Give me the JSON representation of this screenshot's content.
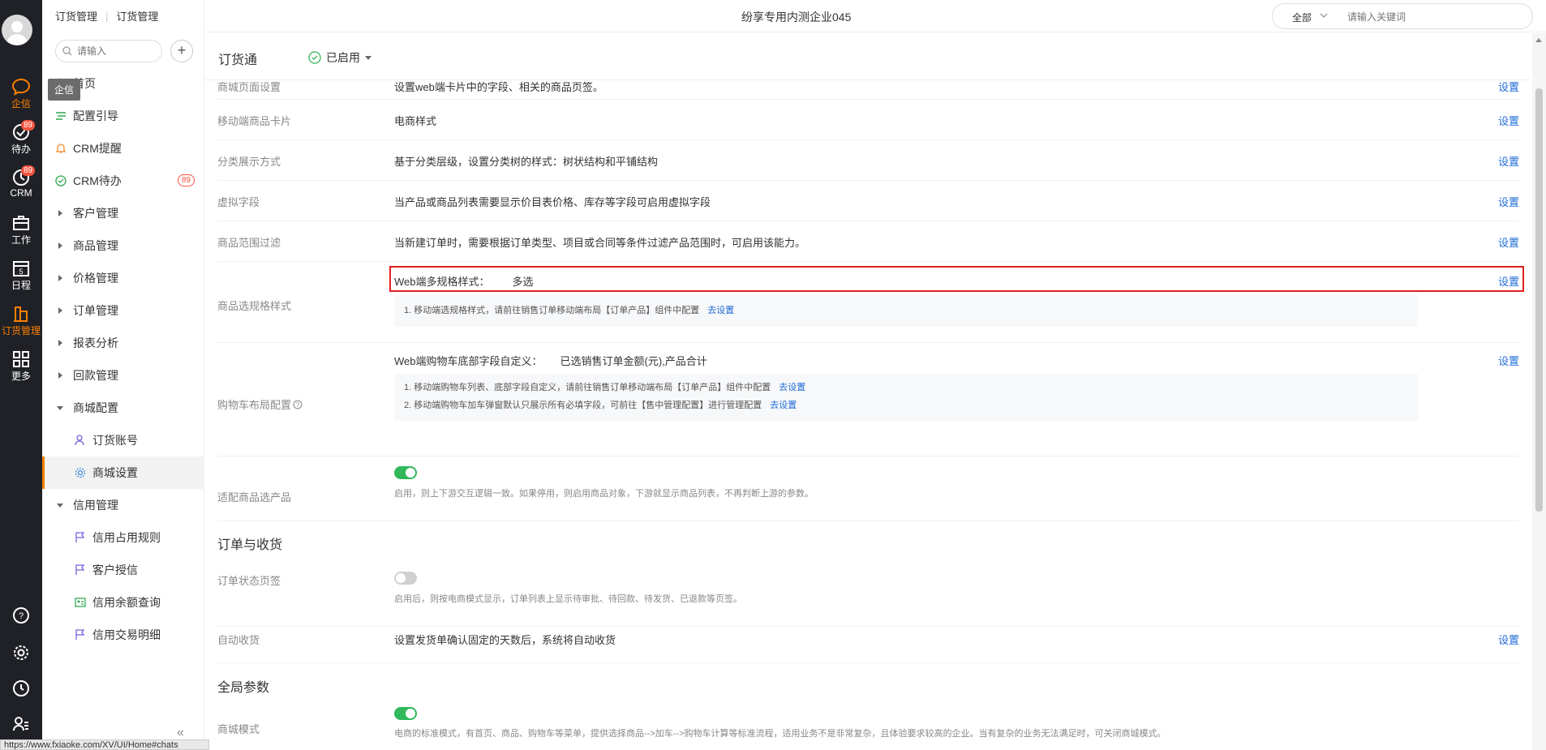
{
  "rail": {
    "items": [
      {
        "label": "企信",
        "icon": "chat-bubble-icon"
      },
      {
        "label": "待办",
        "badge": "89",
        "icon": "check-circle-icon"
      },
      {
        "label": "CRM",
        "badge": "89",
        "icon": "clock-icon"
      },
      {
        "label": "工作",
        "icon": "briefcase-icon"
      },
      {
        "label": "日程",
        "icon": "calendar-icon"
      },
      {
        "label": "订货管理",
        "icon": "order-icon"
      },
      {
        "label": "更多",
        "icon": "grid-icon"
      }
    ],
    "tooltip": "企信"
  },
  "sidebar": {
    "breadcrumb": [
      "订货管理",
      "订货管理"
    ],
    "search_placeholder": "请输入",
    "add_label": "+",
    "items": [
      {
        "label": "首页"
      },
      {
        "label": "配置引导"
      },
      {
        "label": "CRM提醒"
      },
      {
        "label": "CRM待办",
        "badge": "89"
      },
      {
        "label": "客户管理"
      },
      {
        "label": "商品管理"
      },
      {
        "label": "价格管理"
      },
      {
        "label": "订单管理"
      },
      {
        "label": "报表分析"
      },
      {
        "label": "回款管理"
      },
      {
        "label": "商城配置"
      },
      {
        "label": "订货账号"
      },
      {
        "label": "商城设置"
      },
      {
        "label": "信用管理"
      },
      {
        "label": "信用占用规则"
      },
      {
        "label": "客户授信"
      },
      {
        "label": "信用余额查询"
      },
      {
        "label": "信用交易明细"
      }
    ],
    "collapse": "«"
  },
  "status_url": "https://www.fxiaoke.com/XV/UI/Home#chats",
  "topbar": {
    "company": "纷享专用内测企业045",
    "search_scope": "全部",
    "search_placeholder": "请输入关键词"
  },
  "appbar": {
    "name": "订货通",
    "status": "已启用"
  },
  "settings": {
    "action": "设置",
    "rows": [
      {
        "label": "商城页面设置",
        "desc": "设置web端卡片中的字段、相关的商品页签。"
      },
      {
        "label": "移动端商品卡片",
        "desc": "电商样式"
      },
      {
        "label": "分类展示方式",
        "desc": "基于分类层级，设置分类树的样式：树状结构和平铺结构"
      },
      {
        "label": "虚拟字段",
        "desc": "当产品或商品列表需要显示价目表价格、库存等字段可启用虚拟字段"
      },
      {
        "label": "商品范围过滤",
        "desc": "当新建订单时，需要根据订单类型、项目或合同等条件过滤产品范围时，可启用该能力。"
      }
    ],
    "spec": {
      "label": "商品选规格样式",
      "desc_key": "Web端多规格样式：",
      "desc_val": "多选",
      "note": "1. 移动端选规格样式，请前往销售订单移动端布局【订单产品】组件中配置",
      "note_link": "去设置"
    },
    "cart": {
      "label": "购物车布局配置",
      "desc_key": "Web端购物车底部字段自定义：",
      "desc_val": "已选销售订单金额(元),产品合计",
      "note1": "1. 移动端购物车列表、底部字段自定义，请前往销售订单移动端布局【订单产品】组件中配置",
      "note2": "2. 移动端购物车加车弹窗默认只展示所有必填字段，可前往【售中管理配置】进行管理配置",
      "note_link": "去设置"
    },
    "adapt": {
      "label": "适配商品选产品",
      "hint": "启用，则上下游交互逻辑一致。如果停用，则启用商品对象，下游就显示商品列表，不再判断上游的参数。"
    },
    "section_order": "订单与收货",
    "order_tab": {
      "label": "订单状态页签",
      "hint": "启用后，则按电商模式显示，订单列表上显示待审批、待回款、待发货、已退款等页签。"
    },
    "auto_receive": {
      "label": "自动收货",
      "desc": "设置发货单确认固定的天数后，系统将自动收货"
    },
    "section_global": "全局参数",
    "mall_mode": {
      "label": "商城模式",
      "hint": "电商的标准模式，有首页、商品、购物车等菜单，提供选择商品-->加车-->购物车计算等标准流程，适用业务不是非常复杂，且体验要求较高的企业。当有复杂的业务无法满足时，可关闭商城模式。"
    }
  },
  "colors": {
    "rail_bg": "#1f2126",
    "accent": "#ff8000",
    "link": "#1e6bd6",
    "toggle_on": "#30b85a",
    "highlight": "#e02020"
  }
}
